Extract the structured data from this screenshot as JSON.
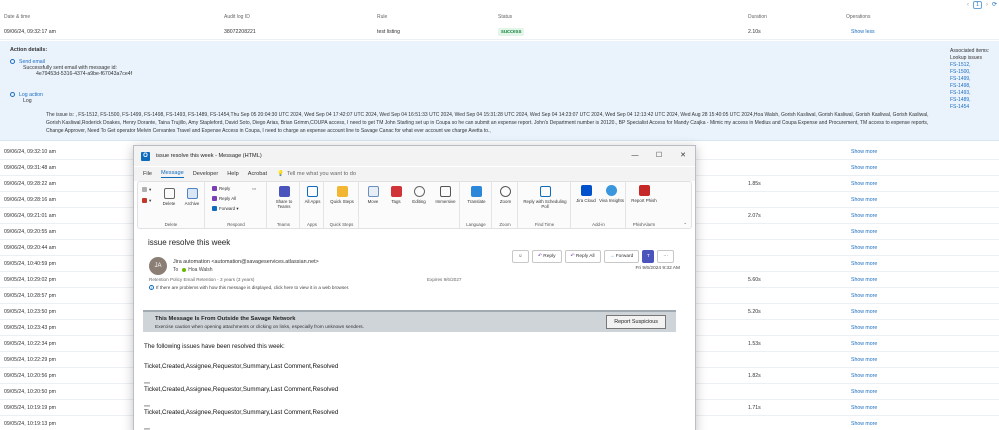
{
  "pager": {
    "current": "1",
    "prev": "‹",
    "next": "›"
  },
  "table": {
    "headers": [
      "Date & time",
      "Audit log ID",
      "Rule",
      "Status",
      "Duration",
      "Operations"
    ],
    "first_row": {
      "date": "09/06/24, 09:32:17 am",
      "id": "38072208221",
      "rule": "test listing",
      "status": "success",
      "duration": "2.10s",
      "op": "Show less"
    },
    "rows": [
      {
        "date": "09/06/24, 09:32:10 am",
        "duration": "",
        "op": "Show more"
      },
      {
        "date": "09/06/24, 09:31:48 am",
        "duration": "",
        "op": "Show more"
      },
      {
        "date": "09/06/24, 09:28:22 am",
        "duration": "1.85s",
        "op": "Show more"
      },
      {
        "date": "09/06/24, 09:28:16 am",
        "duration": "",
        "op": "Show more"
      },
      {
        "date": "09/06/24, 09:21:01 am",
        "duration": "2.07s",
        "op": "Show more"
      },
      {
        "date": "09/06/24, 09:20:55 am",
        "duration": "",
        "op": "Show more"
      },
      {
        "date": "09/06/24, 09:20:44 am",
        "duration": "",
        "op": "Show more"
      },
      {
        "date": "09/05/24, 10:40:59 pm",
        "duration": "",
        "op": "Show more"
      },
      {
        "date": "09/05/24, 10:29:02 pm",
        "duration": "5.60s",
        "op": "Show more"
      },
      {
        "date": "09/05/24, 10:28:57 pm",
        "duration": "",
        "op": "Show more"
      },
      {
        "date": "09/05/24, 10:23:50 pm",
        "duration": "5.20s",
        "op": "Show more"
      },
      {
        "date": "09/05/24, 10:23:43 pm",
        "duration": "",
        "op": "Show more"
      },
      {
        "date": "09/05/24, 10:22:34 pm",
        "duration": "1.53s",
        "op": "Show more"
      },
      {
        "date": "09/05/24, 10:22:29 pm",
        "duration": "",
        "op": "Show more"
      },
      {
        "date": "09/05/24, 10:20:56 pm",
        "duration": "1.82s",
        "op": "Show more"
      },
      {
        "date": "09/05/24, 10:20:50 pm",
        "duration": "",
        "op": "Show more"
      },
      {
        "date": "09/05/24, 10:19:19 pm",
        "duration": "1.71s",
        "op": "Show more"
      },
      {
        "date": "09/05/24, 10:19:13 pm",
        "duration": "",
        "op": "Show more"
      }
    ]
  },
  "details": {
    "header": "Action details:",
    "send_email": {
      "name": "Send email",
      "line1": "Successfully sent email with message id:",
      "line2": "4e79453d-5316-4374-a9be-f67043a7ce4f"
    },
    "log_action": {
      "name": "Log action",
      "line1": "Log"
    },
    "log_text": "The issue is: , FS-1512, FS-1500, FS-1499, FS-1498, FS-1493, FS-1489, FS-1454,Thu Sep 05 20:04:30 UTC 2024, Wed Sep 04 17:42:07 UTC 2024, Wed Sep 04 16:51:33 UTC 2024, Wed Sep 04 15:31:28 UTC 2024, Wed Sep 04 14:23:07 UTC 2024, Wed Sep 04 12:13:42 UTC 2024, Wed Aug 28 15:40:05 UTC 2024,Hoa Walsh, Gorish Kasliwal, Gorish Kasliwal, Gorish Kasliwal, Gorish Kasliwal, Gorish Kasliwal,Roderick Doakes, Henry Dorante, Taina Trujillo, Amy Stapleford, David Soto, Diego Arias, Brian Grimm,COUPA access, I need to get TM John Starling set up in Coupa so he can submit an expense report. John's Department number is 20120., BP Specialist Access for Mandy Czajka - Mimic my access in Medius and Coupa Expense and Procurement, TM access to expense reports, Change Approver, Need To Get operator Melvin Cervantes Travel and Expense Access in Coupa, I need to charge an expense account line to Savage Canac for what ever account we charge Avetta to.,",
    "assoc_title": "Associated items:",
    "assoc_sub": "Lookup issues",
    "assoc_items": [
      "FS-1512,",
      "FS-1500,",
      "FS-1499,",
      "FS-1498,",
      "FS-1493,",
      "FS-1489,",
      "FS-1454"
    ]
  },
  "outlook": {
    "title": "issue resolve this week  -  Message (HTML)",
    "window_controls": [
      "—",
      "☐",
      "✕"
    ],
    "menu": [
      "File",
      "Message",
      "Developer",
      "Help",
      "Acrobat"
    ],
    "tell_me": "Tell me what you want to do",
    "ribbon": {
      "delete": "Delete",
      "archive": "Archive",
      "group_delete": "Delete",
      "reply": "Reply",
      "reply_all": "Reply All",
      "forward": "Forward",
      "group_respond": "Respond",
      "share_teams": "Share to Teams",
      "group_teams": "Teams",
      "all_apps": "All Apps",
      "group_apps": "Apps",
      "quick_steps": "Quick Steps",
      "group_quick": "Quick Steps",
      "move": "Move",
      "tags": "Tags",
      "editing": "Editing",
      "immersive": "Immersive",
      "translate": "Translate",
      "group_language": "Language",
      "zoom": "Zoom",
      "group_zoom": "Zoom",
      "reply_poll": "Reply with Scheduling Poll",
      "group_find": "Find Time",
      "jira": "Jira Cloud",
      "viva": "Viva Insights",
      "group_addin": "Add-in",
      "report_phish": "Report Phish",
      "group_phish": "PhishAlarm"
    },
    "subject": "issue resolve this week",
    "avatar": "JA",
    "sender": "Jira automation <automation@savageservices.atlassian.net>",
    "to_label": "To",
    "to_name": "Hoa Walsh",
    "retention": "Retention Policy   Email Retention - 3 years (3 years)",
    "expires": "Expires   9/6/2027",
    "info": "If there are problems with how this message is displayed, click here to view it in a web browser.",
    "actions": {
      "emoji": "☺",
      "reply": "Reply",
      "reply_all": "Reply All",
      "forward": "Forward",
      "more": "···"
    },
    "date": "Fri 9/6/2024 9:32 AM",
    "banner_title": "This Message Is From Outside the Savage Network",
    "banner_sub": "Exercise caution when opening attachments or clicking on links, especially from unknown senders.",
    "report_suspicious": "Report Suspicious",
    "body_intro": "The following issues have been resolved this week:",
    "body_line": "Ticket,Created,Assignee,Requestor,Summary,Last Comment,Resolved",
    "body_dots": ",,,,,,"
  }
}
